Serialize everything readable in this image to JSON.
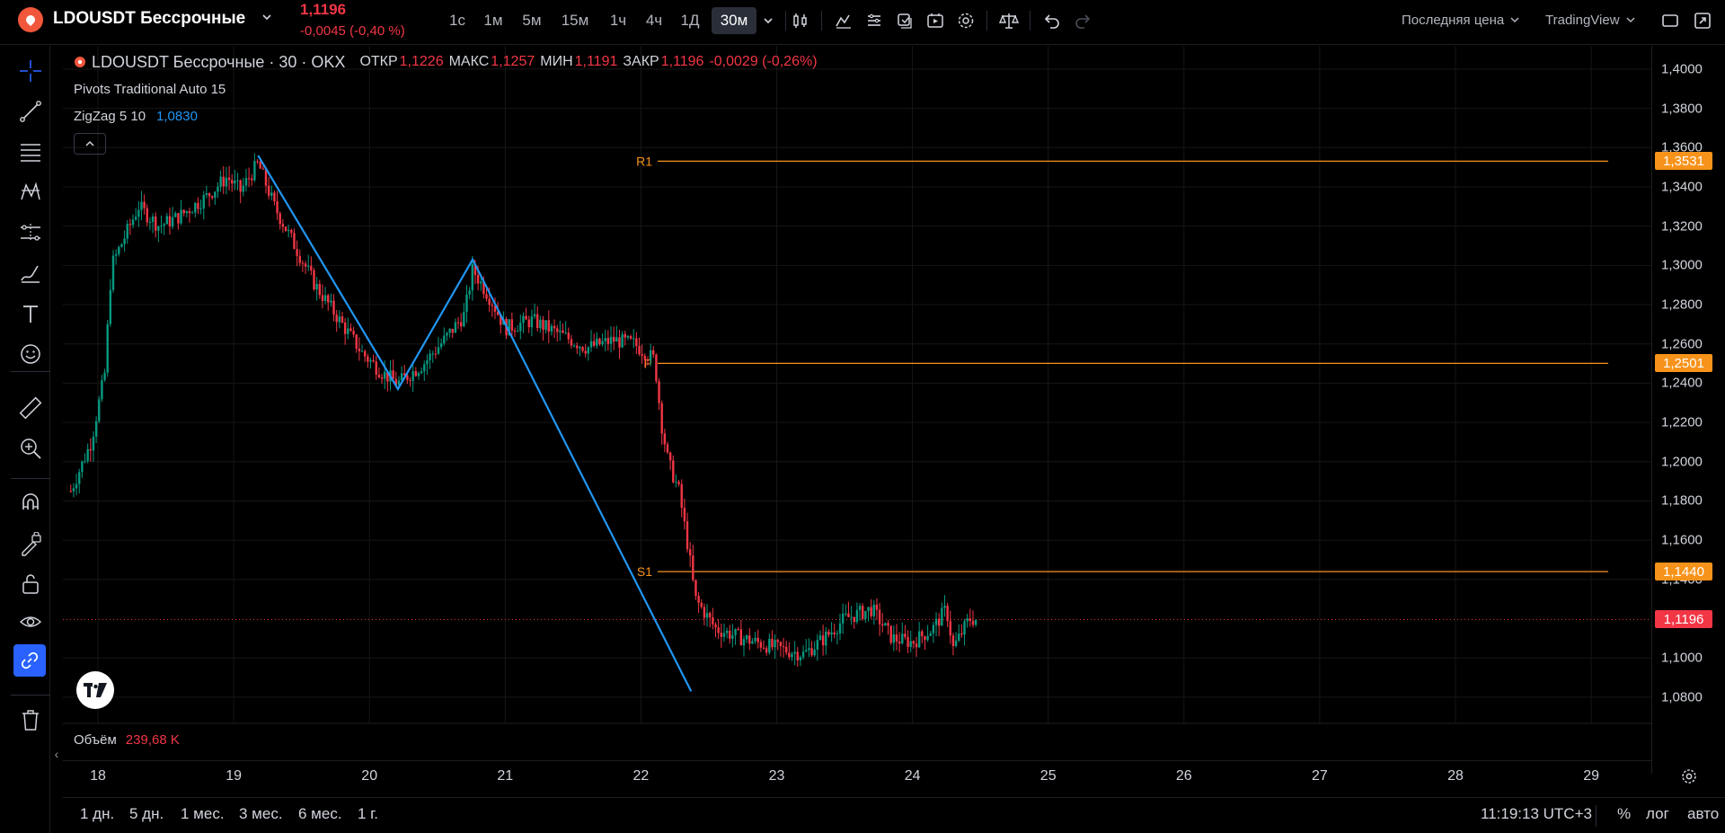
{
  "header": {
    "symbol": "LDOUSDT Бессрочные",
    "last_price": "1,1196",
    "change": "-0,0045 (-0,40 %)",
    "timeframes": [
      {
        "label": "1с",
        "active": false
      },
      {
        "label": "1м",
        "active": false
      },
      {
        "label": "5м",
        "active": false
      },
      {
        "label": "15м",
        "active": false
      },
      {
        "label": "1ч",
        "active": false
      },
      {
        "label": "4ч",
        "active": false
      },
      {
        "label": "1Д",
        "active": false
      },
      {
        "label": "30м",
        "active": true
      }
    ],
    "price_type": "Последняя цена",
    "data_source": "TradingView",
    "icons": [
      "chevron-down-icon",
      "candles-icon",
      "indicators-icon",
      "templates-icon",
      "alert-icon",
      "replay-icon",
      "settings-icon",
      "compare-icon",
      "undo-icon",
      "redo-icon",
      "fullscreen-icon",
      "snapshot-icon"
    ]
  },
  "left_toolbar": {
    "icons": [
      "crosshair-icon",
      "trendline-icon",
      "fib-icon",
      "pattern-icon",
      "prediction-icon",
      "brush-icon",
      "text-icon",
      "emoji-icon",
      "ruler-icon",
      "zoom-icon",
      "magnet-icon",
      "lock-drawing-icon",
      "unlock-icon",
      "eye-icon",
      "link-icon",
      "trash-icon"
    ]
  },
  "legend": {
    "title": "LDOUSDT Бессрочные · 30 · OKX",
    "open_label": "ОТКР",
    "open": "1,1226",
    "high_label": "МАКС",
    "high": "1,1257",
    "low_label": "МИН",
    "low": "1,1191",
    "close_label": "ЗАКР",
    "close": "1,1196",
    "delta": "-0,0029 (-0,26%)",
    "indicator_pivots": "Pivots Traditional Auto 15",
    "indicator_zigzag": "ZigZag 5 10",
    "zigzag_value": "1,0830",
    "volume_label": "Объём",
    "volume_value": "239,68 K"
  },
  "chart_data": {
    "type": "candlestick",
    "symbol": "LDOUSDT",
    "interval": "30",
    "exchange": "OKX",
    "y_ticks": [
      "1,4000",
      "1,3800",
      "1,3600",
      "1,3400",
      "1,3200",
      "1,3000",
      "1,2800",
      "1,2600",
      "1,2400",
      "1,2200",
      "1,2000",
      "1,1800",
      "1,1600",
      "1,1400",
      "1,1000",
      "1,0800"
    ],
    "ylim": [
      1.074,
      1.405
    ],
    "x_ticks": [
      "18",
      "19",
      "20",
      "21",
      "22",
      "23",
      "24",
      "25",
      "26",
      "27",
      "28",
      "29"
    ],
    "pivot_levels": [
      {
        "name": "R1",
        "value": 1.3531,
        "label": "1,3531"
      },
      {
        "name": "P",
        "value": 1.2501,
        "label": "1,2501"
      },
      {
        "name": "S1",
        "value": 1.144,
        "label": "1,1440"
      }
    ],
    "current_price": {
      "value": 1.1196,
      "label": "1,1196"
    },
    "zigzag": [
      {
        "day": 19.18,
        "price": 1.356
      },
      {
        "day": 20.21,
        "price": 1.237
      },
      {
        "day": 20.76,
        "price": 1.303
      },
      {
        "day": 22.37,
        "price": 1.083
      }
    ],
    "price_path": [
      [
        17.8,
        1.185
      ],
      [
        17.95,
        1.21
      ],
      [
        18.05,
        1.245
      ],
      [
        18.1,
        1.3
      ],
      [
        18.2,
        1.315
      ],
      [
        18.3,
        1.33
      ],
      [
        18.45,
        1.32
      ],
      [
        18.6,
        1.325
      ],
      [
        18.8,
        1.335
      ],
      [
        18.95,
        1.345
      ],
      [
        19.05,
        1.338
      ],
      [
        19.18,
        1.352
      ],
      [
        19.3,
        1.33
      ],
      [
        19.45,
        1.31
      ],
      [
        19.6,
        1.29
      ],
      [
        19.8,
        1.27
      ],
      [
        19.95,
        1.255
      ],
      [
        20.1,
        1.245
      ],
      [
        20.21,
        1.24
      ],
      [
        20.4,
        1.25
      ],
      [
        20.55,
        1.262
      ],
      [
        20.7,
        1.275
      ],
      [
        20.76,
        1.298
      ],
      [
        20.9,
        1.282
      ],
      [
        21.0,
        1.268
      ],
      [
        21.2,
        1.272
      ],
      [
        21.4,
        1.265
      ],
      [
        21.6,
        1.258
      ],
      [
        21.8,
        1.262
      ],
      [
        21.95,
        1.26
      ],
      [
        22.1,
        1.252
      ],
      [
        22.15,
        1.22
      ],
      [
        22.2,
        1.2
      ],
      [
        22.28,
        1.185
      ],
      [
        22.35,
        1.155
      ],
      [
        22.4,
        1.13
      ],
      [
        22.55,
        1.115
      ],
      [
        22.75,
        1.11
      ],
      [
        23.0,
        1.105
      ],
      [
        23.2,
        1.102
      ],
      [
        23.35,
        1.11
      ],
      [
        23.5,
        1.12
      ],
      [
        23.7,
        1.125
      ],
      [
        23.85,
        1.11
      ],
      [
        24.0,
        1.108
      ],
      [
        24.15,
        1.115
      ],
      [
        24.25,
        1.125
      ],
      [
        24.3,
        1.105
      ],
      [
        24.42,
        1.12
      ],
      [
        24.47,
        1.1196
      ]
    ]
  },
  "bottom_bar": {
    "ranges": [
      "1 дн.",
      "5 дн.",
      "1 мес.",
      "3 мес.",
      "6 мес.",
      "1 г."
    ],
    "clock": "11:19:13 UTC+3",
    "percent_label": "%",
    "log_label": "лог",
    "auto_label": "авто"
  },
  "colors": {
    "background": "#000000",
    "up": "#089981",
    "down": "#f23645",
    "pivot": "#f7931a",
    "zigzag": "#2196f3",
    "accent": "#2962ff"
  }
}
